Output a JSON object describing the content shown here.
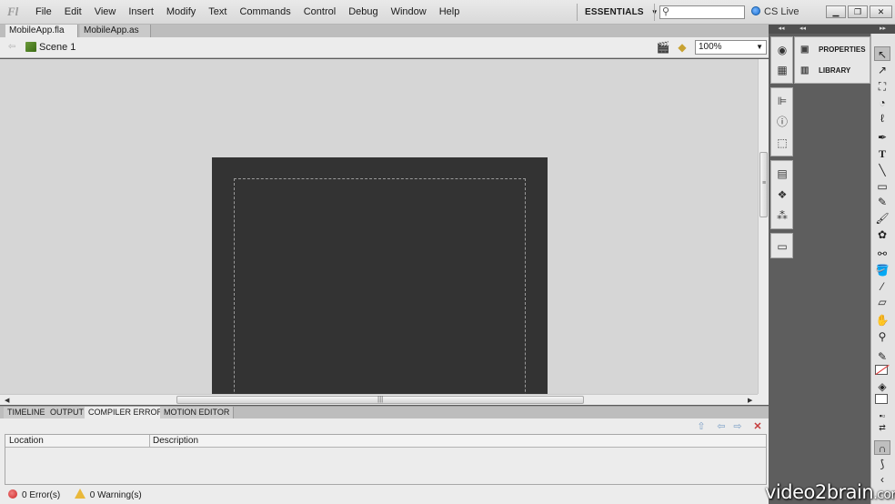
{
  "app": {
    "logo_text": "Fl",
    "menu": [
      "File",
      "Edit",
      "View",
      "Insert",
      "Modify",
      "Text",
      "Commands",
      "Control",
      "Debug",
      "Window",
      "Help"
    ],
    "workspace": "ESSENTIALS",
    "search_value": "",
    "cs_live": "CS Live"
  },
  "doc_tabs": [
    {
      "label": "MobileApp.fla",
      "active": true
    },
    {
      "label": "MobileApp.as",
      "active": false
    }
  ],
  "edit_bar": {
    "scene": "Scene 1",
    "zoom": "100%"
  },
  "bottom_tabs": [
    {
      "label": "TIMELINE",
      "active": false
    },
    {
      "label": "OUTPUT",
      "active": false
    },
    {
      "label": "COMPILER ERRORS",
      "active": true
    },
    {
      "label": "MOTION EDITOR",
      "active": false
    }
  ],
  "compiler_errors": {
    "columns": [
      "Location",
      "Description"
    ],
    "rows": [],
    "errors": "0 Error(s)",
    "warnings": "0 Warning(s)"
  },
  "panels": [
    {
      "label": "PROPERTIES",
      "icon": "properties-icon"
    },
    {
      "label": "LIBRARY",
      "icon": "library-icon"
    }
  ],
  "watermark": {
    "brand": "video2brain",
    "suffix": ".com"
  },
  "colors": {
    "stage": "#333333",
    "pasteboard": "#d6d6d6",
    "dock": "#5e5e5e"
  }
}
